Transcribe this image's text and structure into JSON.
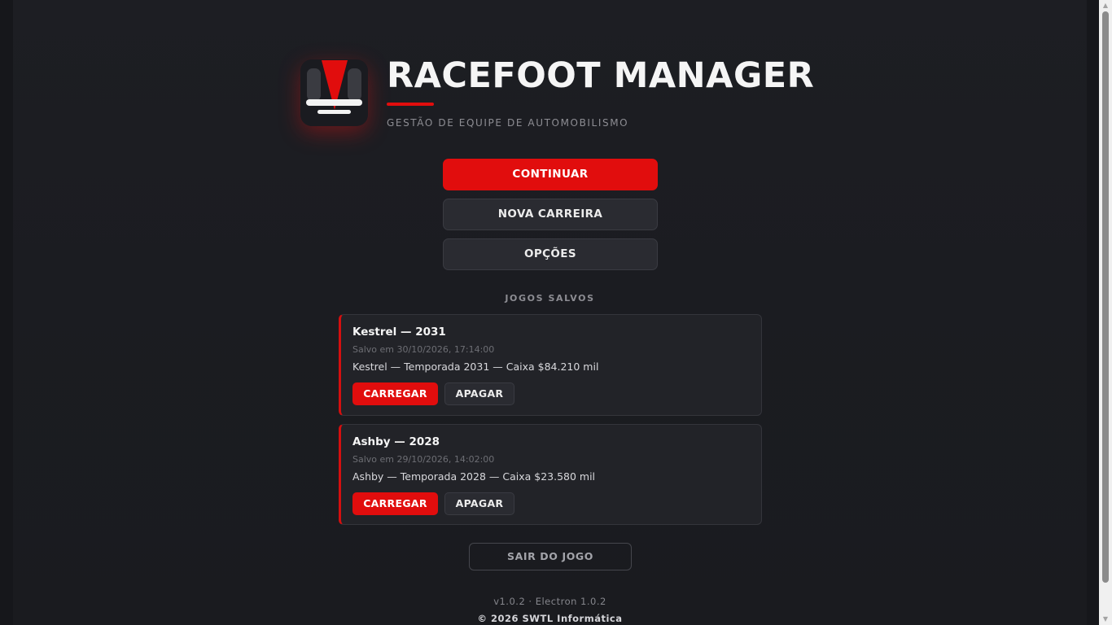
{
  "app": {
    "title": "RACEFOOT MANAGER",
    "subtitle": "GESTÃO DE EQUIPE DE AUTOMOBILISMO",
    "logo_icon": "racefoot-logo-icon"
  },
  "colors": {
    "accent": "#e10d0d",
    "background": "#1c1d22",
    "card": "#222328",
    "secondary_button": "#2a2b31"
  },
  "menu": {
    "continue_label": "CONTINUAR",
    "new_career_label": "NOVA CARREIRA",
    "options_label": "OPÇÕES"
  },
  "saves": {
    "section_title": "JOGOS SALVOS",
    "items": [
      {
        "name": "Kestrel — 2031",
        "date": "Salvo em 30/10/2026, 17:14:00",
        "info": "Kestrel — Temporada 2031 — Caixa $84.210 mil",
        "load_label": "CARREGAR",
        "delete_label": "APAGAR"
      },
      {
        "name": "Ashby — 2028",
        "date": "Salvo em 29/10/2026, 14:02:00",
        "info": "Ashby — Temporada 2028 — Caixa $23.580 mil",
        "load_label": "CARREGAR",
        "delete_label": "APAGAR"
      }
    ]
  },
  "exit": {
    "label": "SAIR DO JOGO"
  },
  "footer": {
    "version": "v1.0.2 · Electron 1.0.2",
    "copyright": "© 2026 SWTL Informática"
  },
  "scrollbar": {
    "up_icon": "▲",
    "down_icon": "▼"
  }
}
